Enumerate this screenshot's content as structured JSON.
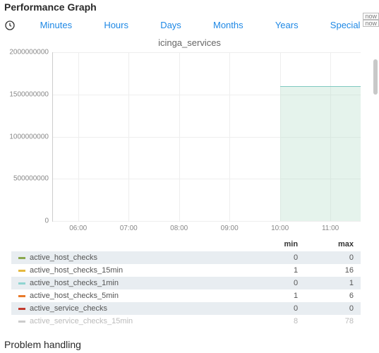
{
  "header": {
    "title": "Performance Graph"
  },
  "tabs": {
    "items": [
      "Minutes",
      "Hours",
      "Days",
      "Months",
      "Years",
      "Special"
    ],
    "now_label": "now"
  },
  "chart_data": {
    "type": "area",
    "title": "icinga_services",
    "xlabel": "",
    "ylabel": "",
    "y_ticks": [
      0,
      500000000,
      1000000000,
      1500000000,
      2000000000
    ],
    "y_tick_labels": [
      "0",
      "500000000",
      "1000000000",
      "1500000000",
      "2000000000"
    ],
    "x_ticks": [
      "06:00",
      "07:00",
      "08:00",
      "09:00",
      "10:00",
      "11:00"
    ],
    "ylim": [
      0,
      2000000000
    ],
    "xlim_hours": [
      5.5,
      11.6
    ],
    "series": [
      {
        "name": "active_host_checks",
        "color": "#8aa84f",
        "min": 0,
        "max": 0
      },
      {
        "name": "active_host_checks_15min",
        "color": "#e5b93f",
        "min": 1,
        "max": 16
      },
      {
        "name": "active_host_checks_1min",
        "color": "#8fd4d1",
        "min": 0,
        "max": 1
      },
      {
        "name": "active_host_checks_5min",
        "color": "#e87a2a",
        "min": 1,
        "max": 6
      },
      {
        "name": "active_service_checks",
        "color": "#c23b2e",
        "min": 0,
        "max": 0
      },
      {
        "name": "active_service_checks_15min",
        "color": "#cccccc",
        "min": 8,
        "max": 78
      }
    ],
    "visible_area": {
      "x_start_hour": 10.0,
      "x_end_hour": 11.6,
      "value": 1600000000
    }
  },
  "legend": {
    "columns": [
      "",
      "min",
      "max"
    ]
  },
  "footer": {
    "title": "Problem handling"
  }
}
